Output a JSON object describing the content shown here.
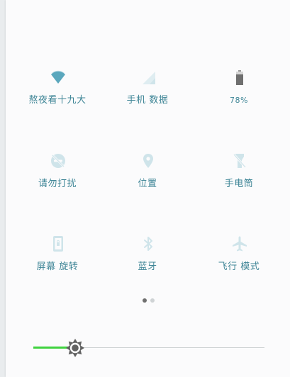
{
  "colors": {
    "accent": "#3e8596",
    "icon_active": "#5aa7bd",
    "icon_inactive": "#cfe4ea",
    "battery": "#6f6f6f",
    "slider_fill": "#3fd23f",
    "slider_thumb": "#616161"
  },
  "tiles": [
    {
      "label": "熬夜看十九大",
      "icon": "wifi-icon",
      "active": true
    },
    {
      "label": "手机 数据",
      "icon": "cellular-signal-icon",
      "active": false
    },
    {
      "label": "78%",
      "icon": "battery-icon",
      "active": true
    },
    {
      "label": "请勿打扰",
      "icon": "do-not-disturb-icon",
      "active": false
    },
    {
      "label": "位置",
      "icon": "location-pin-icon",
      "active": false
    },
    {
      "label": "手电筒",
      "icon": "flashlight-icon",
      "active": false
    },
    {
      "label": "屏幕 旋转",
      "icon": "screen-rotation-icon",
      "active": false
    },
    {
      "label": "蓝牙",
      "icon": "bluetooth-icon",
      "active": false
    },
    {
      "label": "飞行 模式",
      "icon": "airplane-icon",
      "active": false
    }
  ],
  "battery_level": 0.78,
  "pager": {
    "pages": 2,
    "current": 1
  },
  "brightness": {
    "level": 0.18,
    "icon": "brightness-icon"
  }
}
